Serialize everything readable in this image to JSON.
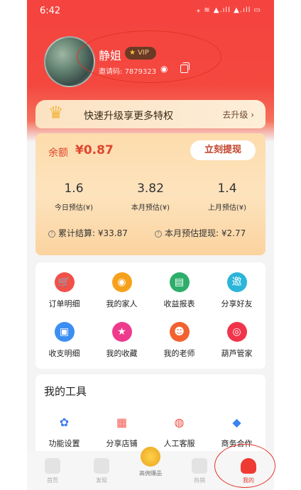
{
  "status_bar": {
    "time": "6:42",
    "icons": "⁎ ≋ ▲.ıll ▲.ıll ▭"
  },
  "profile": {
    "nickname": "静姐",
    "vip_label": "VIP",
    "invite_label": "邀请码:",
    "invite_code": "7879323"
  },
  "upgrade_banner": {
    "text": "快速升级享更多特权",
    "link": "去升级 ›"
  },
  "balance": {
    "label": "余额",
    "value": "¥0.87",
    "withdraw_button": "立刻提现",
    "stats": [
      {
        "value": "1.6",
        "label": "今日预估(¥)"
      },
      {
        "value": "3.82",
        "label": "本月预估(¥)"
      },
      {
        "value": "1.4",
        "label": "上月预估(¥)"
      }
    ],
    "settled": "累计结算: ¥33.87",
    "month_withdraw": "本月预估提现: ¥2.77"
  },
  "grid": [
    {
      "label": "订单明细",
      "icon": "cart-icon",
      "color": "#f2514a",
      "glyph": "🛒"
    },
    {
      "label": "我的家人",
      "icon": "family-icon",
      "color": "#f6a11c",
      "glyph": "◉"
    },
    {
      "label": "收益报表",
      "icon": "report-icon",
      "color": "#2dae6a",
      "glyph": "▤"
    },
    {
      "label": "分享好友",
      "icon": "share-friends-icon",
      "color": "#2ab5d9",
      "glyph": "邀"
    },
    {
      "label": "收支明细",
      "icon": "ledger-icon",
      "color": "#3b8ff2",
      "glyph": "▣"
    },
    {
      "label": "我的收藏",
      "icon": "star-icon",
      "color": "#ee3b8d",
      "glyph": "★"
    },
    {
      "label": "我的老师",
      "icon": "teacher-icon",
      "color": "#f2612f",
      "glyph": "☻"
    },
    {
      "label": "葫芦管家",
      "icon": "butler-icon",
      "color": "#f0354b",
      "glyph": "◎"
    }
  ],
  "tools": {
    "title": "我的工具",
    "items": [
      {
        "label": "功能设置",
        "icon": "settings-icon",
        "color": "#3f7df0",
        "glyph": "✿"
      },
      {
        "label": "分享店铺",
        "icon": "shop-icon",
        "color": "#f2574f",
        "glyph": "▦"
      },
      {
        "label": "人工客服",
        "icon": "service-icon",
        "color": "#f24c3f",
        "glyph": "◍"
      },
      {
        "label": "商务合作",
        "icon": "handshake-icon",
        "color": "#3b84f0",
        "glyph": "◆"
      }
    ]
  },
  "tabbar": [
    {
      "label": "首页",
      "icon": "home-icon"
    },
    {
      "label": "发现",
      "icon": "discover-icon"
    },
    {
      "label": "高佣爆品",
      "icon": "hot-deals-icon"
    },
    {
      "label": "热销",
      "icon": "hot-sale-icon"
    },
    {
      "label": "我的",
      "icon": "profile-icon"
    }
  ]
}
